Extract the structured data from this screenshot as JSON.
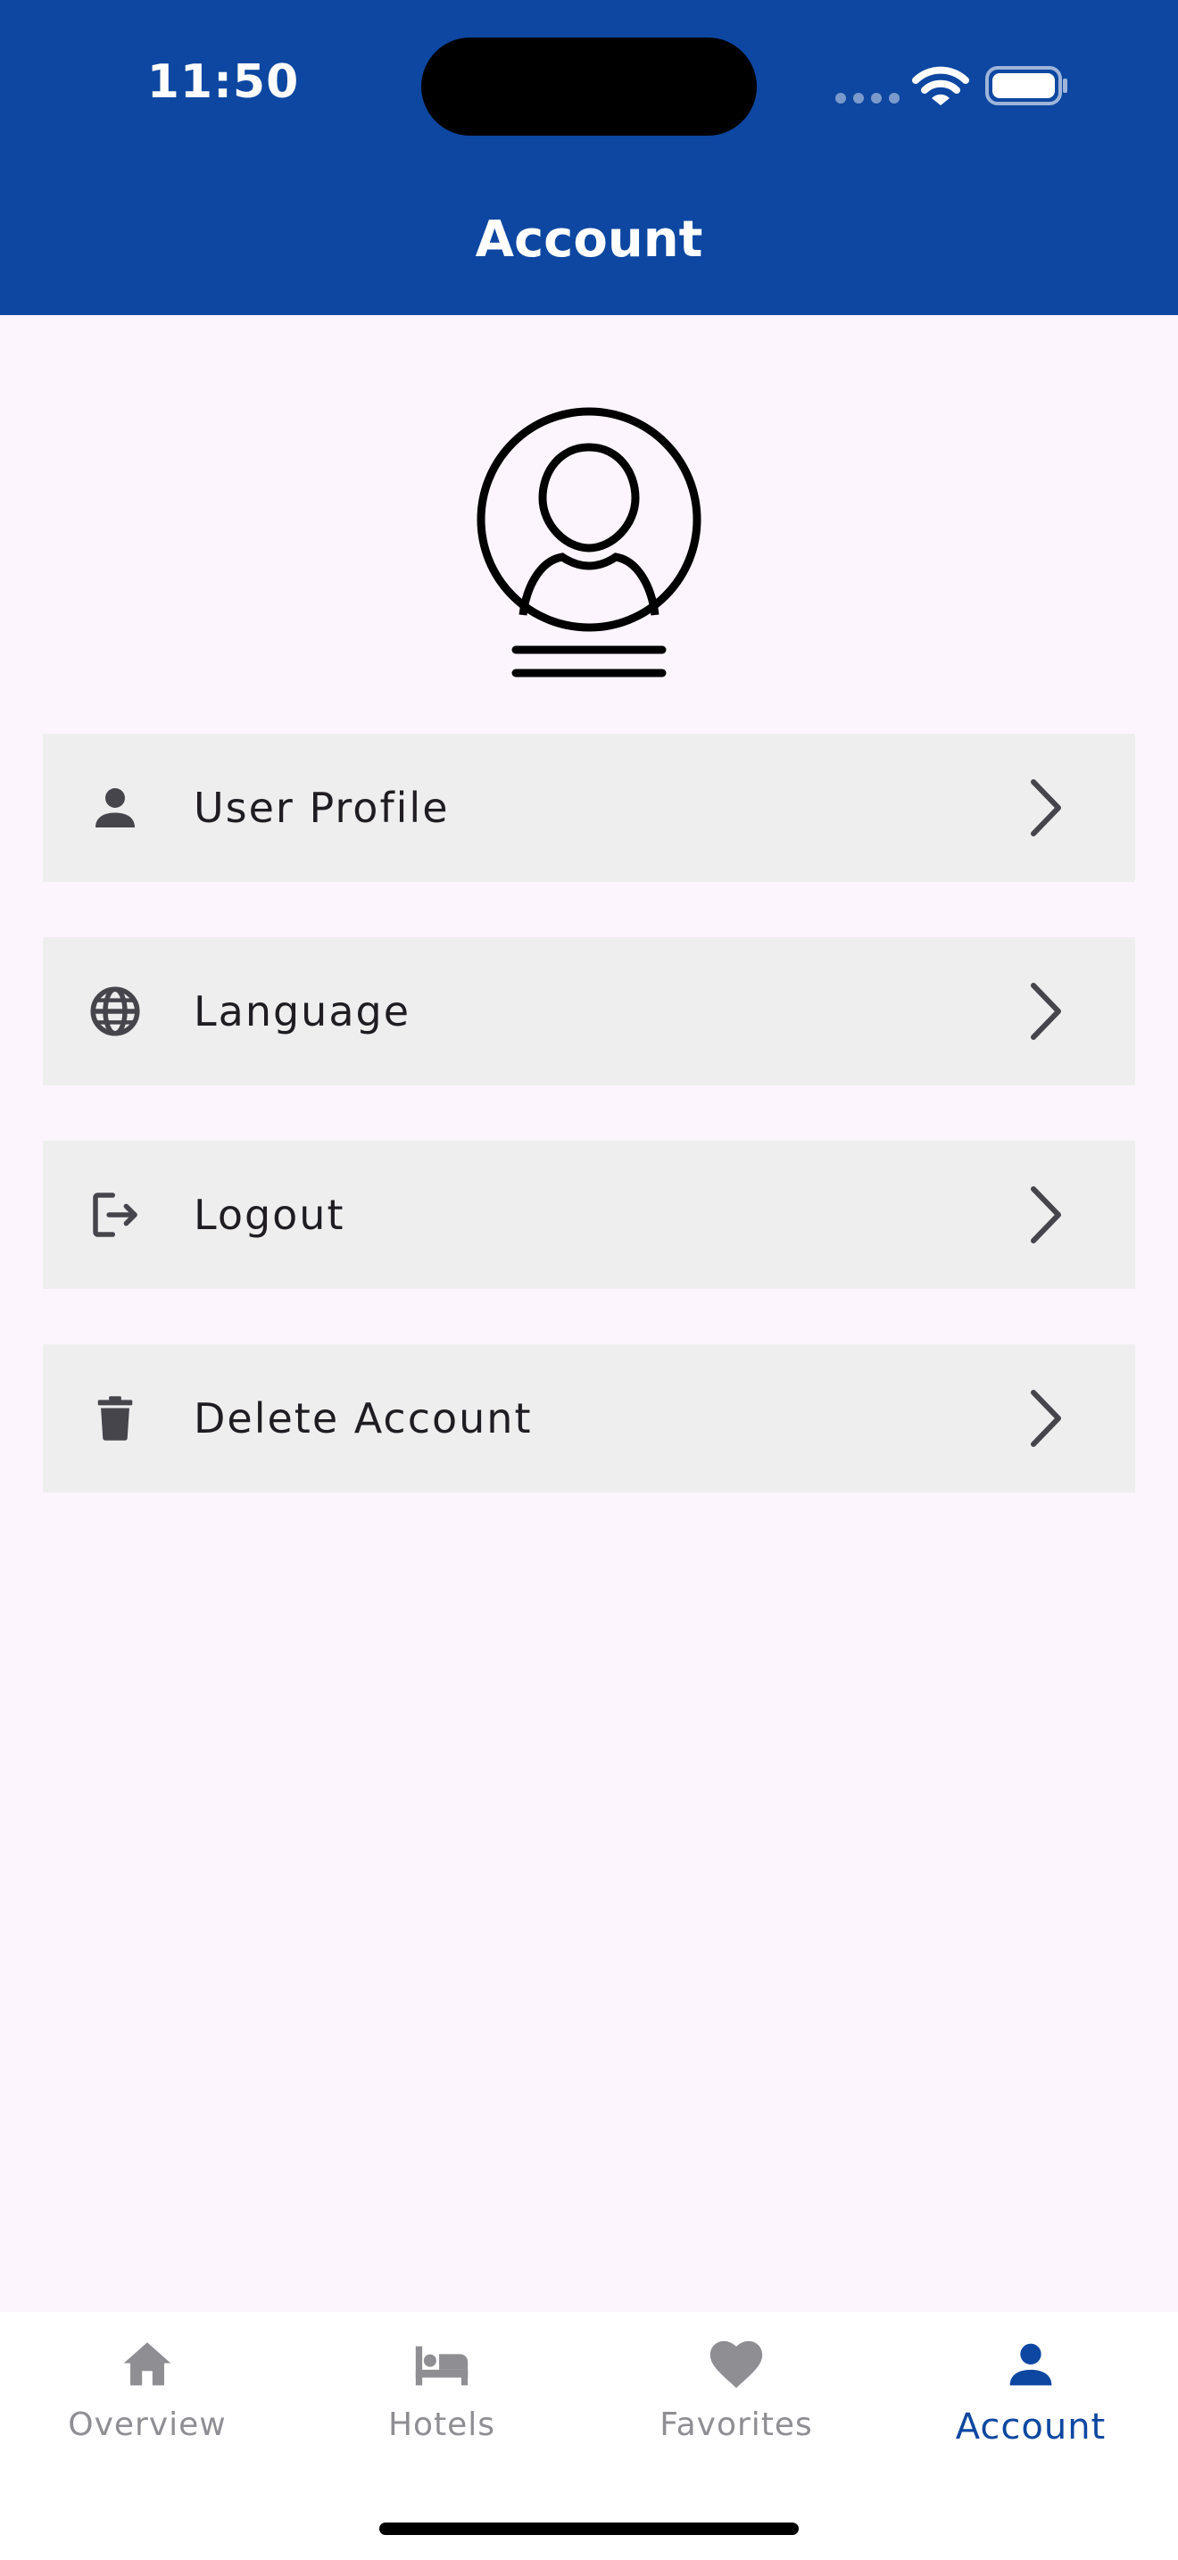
{
  "status_bar": {
    "time": "11:50"
  },
  "header": {
    "title": "Account",
    "background_color": "#0d47a1"
  },
  "avatar": {
    "icon": "user-profile-icon"
  },
  "menu": {
    "items": [
      {
        "label": "User Profile",
        "icon": "person-icon"
      },
      {
        "label": "Language",
        "icon": "globe-icon"
      },
      {
        "label": "Logout",
        "icon": "logout-icon"
      },
      {
        "label": "Delete Account",
        "icon": "trash-icon"
      }
    ]
  },
  "bottom_nav": {
    "items": [
      {
        "label": "Overview",
        "icon": "home-icon",
        "active": false
      },
      {
        "label": "Hotels",
        "icon": "bed-icon",
        "active": false
      },
      {
        "label": "Favorites",
        "icon": "heart-icon",
        "active": false
      },
      {
        "label": "Account",
        "icon": "person-icon",
        "active": true
      }
    ],
    "active_color": "#0d47a1",
    "inactive_color": "#8e8e93"
  }
}
